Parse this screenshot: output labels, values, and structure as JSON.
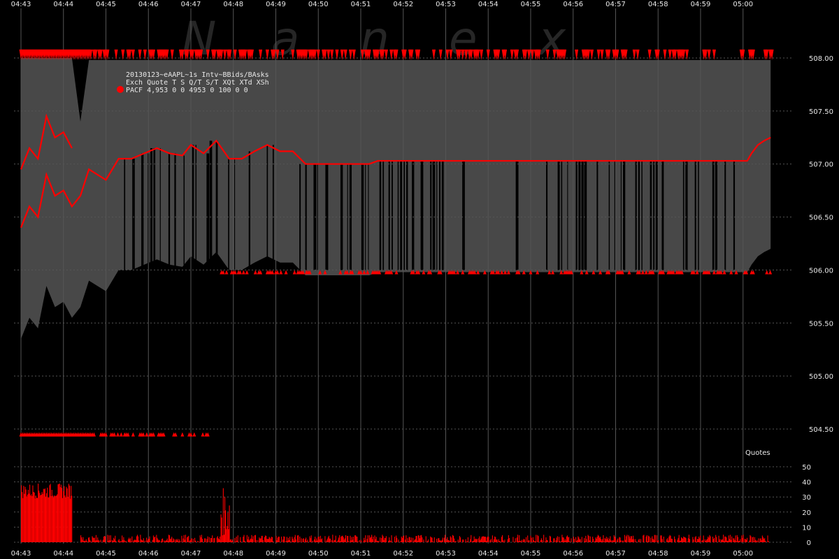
{
  "watermark": [
    "N",
    "a",
    "n",
    "e",
    "x"
  ],
  "info": {
    "title": "20130123~eAAPL~1s Intv~BBids/BAsks",
    "header": "Exch Quote T S  Q/T   S/T  XQt XTd XSh",
    "row": "PACF 4,953 0 0  4953     0 100   0   0"
  },
  "colors": {
    "background": "#000000",
    "fill_band": "#484848",
    "accent": "#ff0000",
    "grid": "#555555",
    "text": "#e8e8e8"
  },
  "chart_data": [
    {
      "type": "area",
      "title": "20130123~eAAPL~1s Intv~BBids/BAsks",
      "x_ticks": [
        "04:43",
        "04:44",
        "04:45",
        "04:46",
        "04:47",
        "04:48",
        "04:49",
        "04:50",
        "04:51",
        "04:52",
        "04:53",
        "04:54",
        "04:55",
        "04:56",
        "04:57",
        "04:58",
        "04:59",
        "05:00"
      ],
      "y_ticks": [
        "504.50",
        "505.00",
        "505.50",
        "506.00",
        "506.50",
        "507.00",
        "507.50",
        "508.00"
      ],
      "ylim": [
        504.3,
        508.35
      ],
      "grid": true,
      "legend": "top-left",
      "series": [
        {
          "name": "PACF",
          "values": [
            [
              0.0,
              506.4,
              508.0
            ],
            [
              0.2,
              506.6,
              508.0
            ],
            [
              0.4,
              506.5,
              508.0
            ],
            [
              0.6,
              506.9,
              508.0
            ],
            [
              0.8,
              506.7,
              508.0
            ],
            [
              1.0,
              506.75,
              508.0
            ],
            [
              1.2,
              506.6,
              508.0
            ],
            [
              1.4,
              506.7,
              507.4
            ],
            [
              1.6,
              506.95,
              507.98
            ],
            [
              1.8,
              506.9,
              507.98
            ],
            [
              2.0,
              506.85,
              507.98
            ],
            [
              2.3,
              507.05,
              507.98
            ],
            [
              2.6,
              507.05,
              507.98
            ],
            [
              2.9,
              507.1,
              507.98
            ],
            [
              3.2,
              507.15,
              507.98
            ],
            [
              3.5,
              507.1,
              507.98
            ],
            [
              3.8,
              507.08,
              507.98
            ],
            [
              4.0,
              507.18,
              507.98
            ],
            [
              4.3,
              507.1,
              507.98
            ],
            [
              4.6,
              507.22,
              507.98
            ],
            [
              4.9,
              507.05,
              507.98
            ],
            [
              5.2,
              507.05,
              507.98
            ],
            [
              5.5,
              507.12,
              507.98
            ],
            [
              5.8,
              507.18,
              507.98
            ],
            [
              6.1,
              507.12,
              507.98
            ],
            [
              6.4,
              507.12,
              507.98
            ],
            [
              6.7,
              507.0,
              507.98
            ],
            [
              7.0,
              507.0,
              507.98
            ],
            [
              7.3,
              507.0,
              507.98
            ],
            [
              7.6,
              507.0,
              507.98
            ],
            [
              7.9,
              507.0,
              507.98
            ],
            [
              8.2,
              507.0,
              507.98
            ],
            [
              8.4,
              507.03,
              507.98
            ],
            [
              8.7,
              507.03,
              507.98
            ],
            [
              9.0,
              507.03,
              507.98
            ],
            [
              9.3,
              507.03,
              507.98
            ],
            [
              9.6,
              507.03,
              507.98
            ],
            [
              9.9,
              507.03,
              507.98
            ],
            [
              10.2,
              507.03,
              507.98
            ],
            [
              10.5,
              507.03,
              507.98
            ],
            [
              10.8,
              507.03,
              507.98
            ],
            [
              11.1,
              507.03,
              507.98
            ],
            [
              11.4,
              507.03,
              507.98
            ],
            [
              11.7,
              507.03,
              507.98
            ],
            [
              12.0,
              507.03,
              507.98
            ],
            [
              12.3,
              507.03,
              507.98
            ],
            [
              12.6,
              507.03,
              507.98
            ],
            [
              12.9,
              507.03,
              507.98
            ],
            [
              13.2,
              507.03,
              507.98
            ],
            [
              13.5,
              507.03,
              507.98
            ],
            [
              13.8,
              507.03,
              507.98
            ],
            [
              14.1,
              507.03,
              507.98
            ],
            [
              14.4,
              507.03,
              507.98
            ],
            [
              14.7,
              507.03,
              507.98
            ],
            [
              15.0,
              507.03,
              507.98
            ],
            [
              15.3,
              507.03,
              507.98
            ],
            [
              15.6,
              507.03,
              507.98
            ],
            [
              15.9,
              507.03,
              507.98
            ],
            [
              16.2,
              507.03,
              507.98
            ],
            [
              16.5,
              507.03,
              507.98
            ],
            [
              16.8,
              507.03,
              507.98
            ],
            [
              17.1,
              507.03,
              507.98
            ],
            [
              17.1,
              507.03,
              507.98
            ],
            [
              17.2,
              507.1,
              507.98
            ],
            [
              17.35,
              507.18,
              507.98
            ],
            [
              17.5,
              507.22,
              507.98
            ],
            [
              17.65,
              507.25,
              507.98
            ]
          ]
        }
      ],
      "bid_ask_labels": {
        "x": "time",
        "low": "bid",
        "high": "ask"
      }
    },
    {
      "type": "bar",
      "title": "Quotes",
      "y_ticks": [
        "0",
        "10",
        "20",
        "30",
        "40",
        "50"
      ],
      "ylim": [
        0,
        55
      ],
      "grid": true,
      "segments": [
        {
          "x_start": 0.0,
          "x_end": 1.2,
          "level": 34,
          "jitter": 5
        },
        {
          "x_start": 1.2,
          "x_end": 1.4,
          "level": 0,
          "jitter": 0
        },
        {
          "x_start": 1.4,
          "x_end": 4.7,
          "level": 2,
          "jitter": 3
        },
        {
          "x_start": 4.7,
          "x_end": 4.9,
          "level": 20,
          "jitter": 16
        },
        {
          "x_start": 4.9,
          "x_end": 17.6,
          "level": 2,
          "jitter": 3
        }
      ]
    }
  ]
}
